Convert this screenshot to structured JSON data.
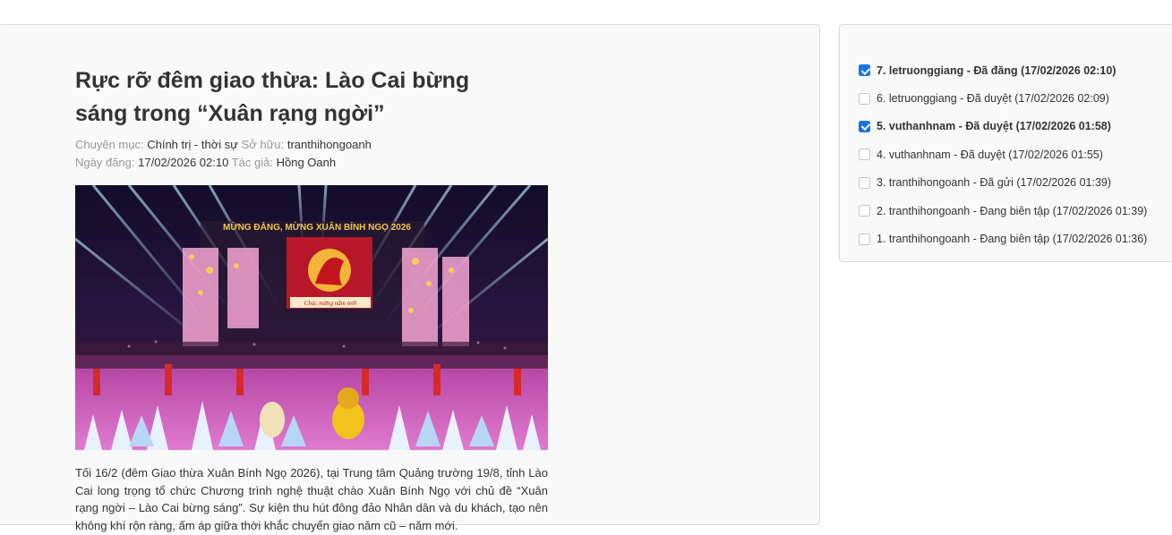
{
  "article": {
    "title": "Rực rỡ đêm giao thừa: Lào Cai bừng sáng trong “Xuân rạng ngời”",
    "category_label": "Chuyên mục:",
    "category_value": "Chính trị - thời sự",
    "owner_label": "Sở hữu:",
    "owner_value": "tranthihongoanh",
    "date_label": "Ngày đăng:",
    "date_value": "17/02/2026 02:10",
    "author_label": "Tác giả:",
    "author_value": "Hồng Oanh",
    "banner_text": "MỪNG ĐẢNG, MỪNG XUÂN BÍNH NGỌ 2026",
    "banner_text_2": "Chúc mừng năm mới",
    "body": "Tối 16/2 (đêm Giao thừa Xuân Bính Ngọ 2026), tại Trung tâm Quảng trường 19/8, tỉnh Lào Cai long trọng tổ chức Chương trình nghệ thuật chào Xuân Bính Ngọ với chủ đề “Xuân rạng ngời – Lào Cai bừng sáng”. Sự kiện thu hút đông đảo Nhân dân và du khách, tạo nên không khí rộn ràng, ấm áp giữa thời khắc chuyển giao năm cũ – năm mới."
  },
  "history": [
    {
      "label": "7. letruonggiang - Đã đăng (17/02/2026 02:10)",
      "checked": true
    },
    {
      "label": "6. letruonggiang - Đã duyệt (17/02/2026 02:09)",
      "checked": false
    },
    {
      "label": "5. vuthanhnam - Đã duyệt (17/02/2026 01:58)",
      "checked": true
    },
    {
      "label": "4. vuthanhnam - Đã duyệt (17/02/2026 01:55)",
      "checked": false
    },
    {
      "label": "3. tranthihongoanh - Đã gửi (17/02/2026 01:39)",
      "checked": false
    },
    {
      "label": "2. tranthihongoanh - Đang biên tập (17/02/2026 01:39)",
      "checked": false
    },
    {
      "label": "1. tranthihongoanh - Đang biên tập (17/02/2026 01:36)",
      "checked": false
    }
  ],
  "colors": {
    "checkbox_checked": "#1a73e8",
    "panel_bg": "#f9f9f9",
    "meta_label": "#999999"
  }
}
